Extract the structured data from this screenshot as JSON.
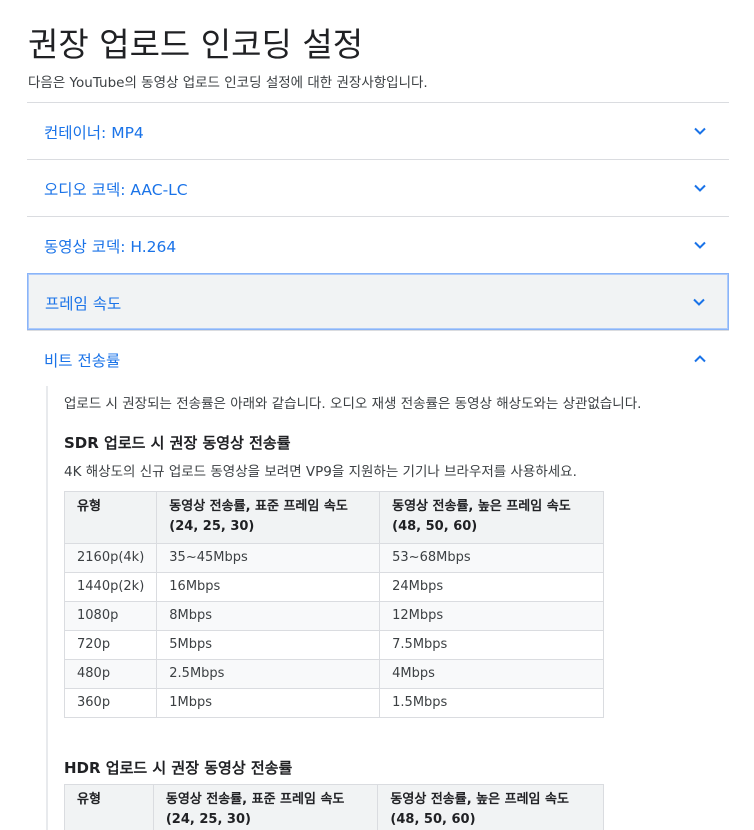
{
  "page": {
    "title": "권장 업로드 인코딩 설정",
    "intro": "다음은 YouTube의 동영상 업로드 인코딩 설정에 대한 권장사항입니다."
  },
  "accordion": [
    {
      "title": "컨테이너: MP4",
      "icon": "chevron-down-icon"
    },
    {
      "title": "오디오 코덱: AAC-LC",
      "icon": "chevron-down-icon"
    },
    {
      "title": "동영상 코덱: H.264",
      "icon": "chevron-down-icon"
    },
    {
      "title": "프레임 속도",
      "icon": "chevron-down-icon"
    },
    {
      "title": "비트 전송률",
      "icon": "chevron-up-icon"
    }
  ],
  "bitrate_panel": {
    "intro": "업로드 시 권장되는 전송률은 아래와 같습니다. 오디오 재생 전송률은 동영상 해상도와는 상관없습니다.",
    "sdr": {
      "heading": "SDR 업로드 시 권장 동영상 전송률",
      "note": "4K 해상도의 신규 업로드 동영상을 보려면 VP9을 지원하는 기기나 브라우저를 사용하세요.",
      "headers": [
        "유형",
        "동영상 전송률, 표준 프레임 속도",
        "동영상 전송률, 높은 프레임 속도"
      ],
      "header_sub": [
        "",
        "(24, 25, 30)",
        "(48, 50, 60)"
      ],
      "rows": [
        [
          "2160p(4k)",
          "35~45Mbps",
          "53~68Mbps"
        ],
        [
          "1440p(2k)",
          "16Mbps",
          "24Mbps"
        ],
        [
          "1080p",
          "8Mbps",
          "12Mbps"
        ],
        [
          "720p",
          "5Mbps",
          "7.5Mbps"
        ],
        [
          "480p",
          "2.5Mbps",
          "4Mbps"
        ],
        [
          "360p",
          "1Mbps",
          "1.5Mbps"
        ]
      ]
    },
    "hdr": {
      "heading": "HDR 업로드 시 권장 동영상 전송률",
      "headers": [
        "유형",
        "동영상 전송률, 표준 프레임 속도",
        "동영상 전송률, 높은 프레임 속도"
      ],
      "header_sub": [
        "",
        "(24, 25, 30)",
        "(48, 50, 60)"
      ]
    }
  },
  "colors": {
    "link": "#1a73e8",
    "divider": "#dadce0",
    "focus_bg": "#f1f3f4",
    "focus_border": "#8ab4f8"
  }
}
